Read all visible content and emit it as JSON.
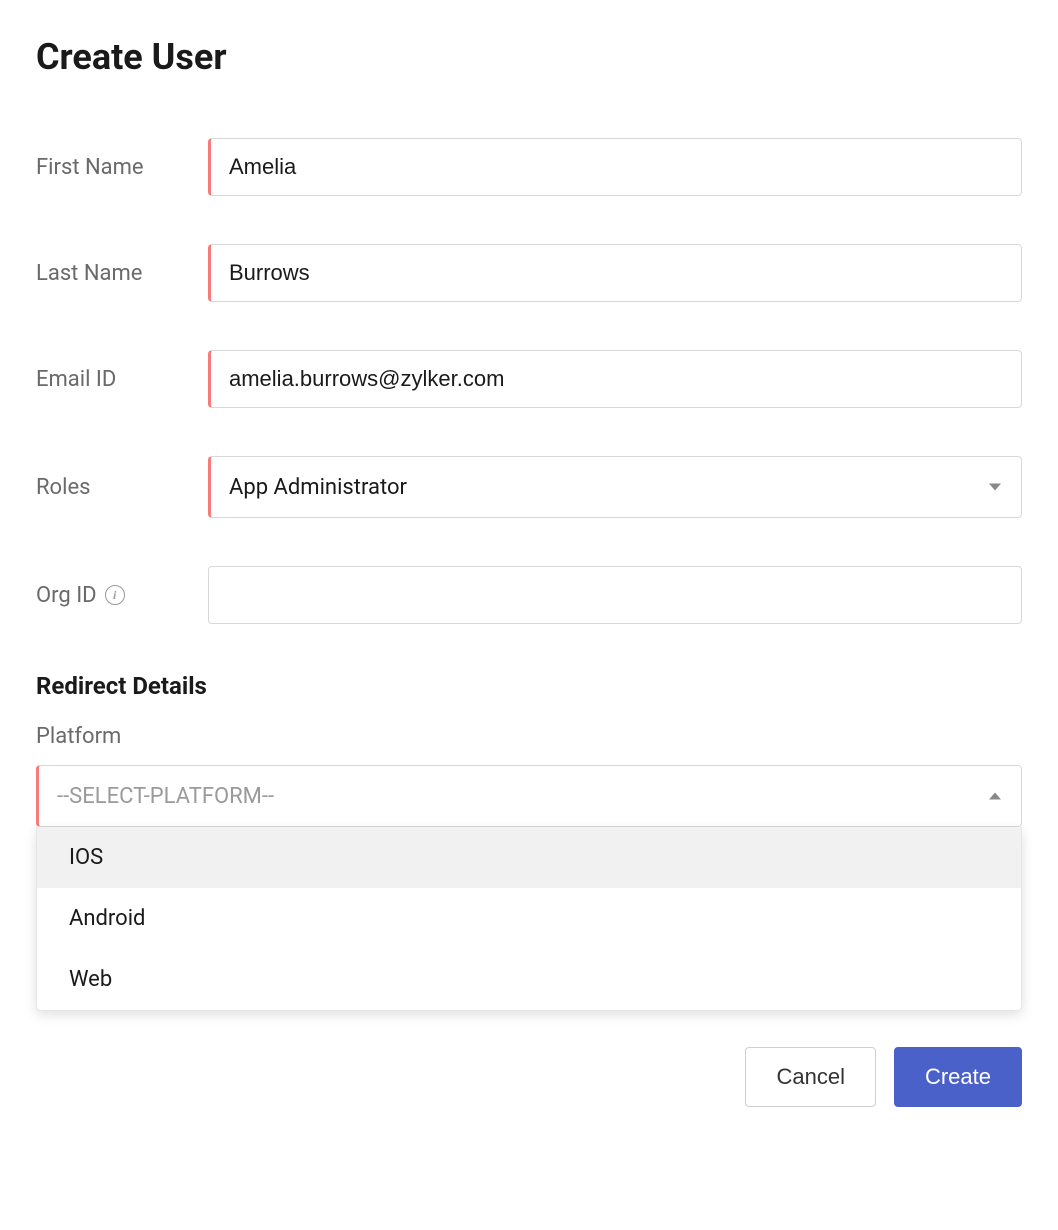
{
  "page": {
    "title": "Create User"
  },
  "form": {
    "first_name": {
      "label": "First Name",
      "value": "Amelia"
    },
    "last_name": {
      "label": "Last Name",
      "value": "Burrows"
    },
    "email_id": {
      "label": "Email ID",
      "value": "amelia.burrows@zylker.com"
    },
    "roles": {
      "label": "Roles",
      "selected": "App Administrator"
    },
    "org_id": {
      "label": "Org ID",
      "value": ""
    }
  },
  "redirect": {
    "heading": "Redirect Details",
    "platform_label": "Platform",
    "platform_placeholder": "--SELECT-PLATFORM--",
    "options": [
      "IOS",
      "Android",
      "Web"
    ]
  },
  "buttons": {
    "cancel": "Cancel",
    "create": "Create"
  }
}
